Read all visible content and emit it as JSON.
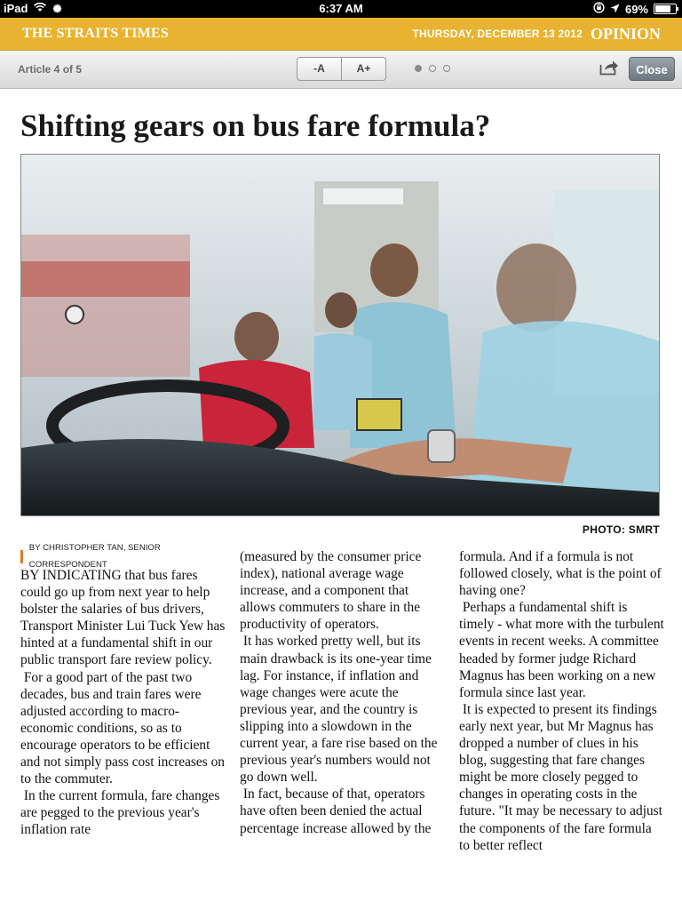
{
  "status_bar": {
    "device": "iPad",
    "time": "6:37 AM",
    "battery": "69%"
  },
  "banner": {
    "brand": "THE STRAITS TIMES",
    "date": "THURSDAY, DECEMBER 13 2012",
    "section": "OPINION"
  },
  "toolbar": {
    "counter": "Article 4 of 5",
    "decrease_font_label": "-A",
    "increase_font_label": "A+",
    "page_dots": [
      {
        "active": true
      },
      {
        "active": false
      },
      {
        "active": false
      }
    ],
    "close_label": "Close"
  },
  "article": {
    "headline": "Shifting gears on bus fare formula?",
    "photo_credit": "PHOTO: SMRT",
    "byline": "BY CHRISTOPHER TAN, SENIOR CORRESPONDENT",
    "columns": [
      [
        "BY INDICATING that bus fares could go up from next year to help bolster the salaries of bus drivers, Transport Minister Lui Tuck Yew has hinted at a fundamental shift in our public transport fare review policy.",
        "For a good part of the past two decades, bus and train fares were adjusted according to macro-economic conditions, so as to encourage operators to be efficient and not simply pass cost increases on to the commuter.",
        "In the current formula, fare changes are pegged to the previous year's inflation rate"
      ],
      [
        "(measured by the consumer price index), national average wage increase, and a component that allows commuters to share in the productivity of operators.",
        "It has worked pretty well, but its main drawback is its one-year time lag. For instance, if inflation and wage changes were acute the previous year, and the country is slipping into a slowdown in the current year, a fare rise based on the previous year's numbers would not go down well.",
        "In fact, because of that, operators have often been denied the actual percentage increase allowed by the"
      ],
      [
        "formula. And if a formula is not followed closely, what is the point of having one?",
        "Perhaps a fundamental shift is timely - what more with the turbulent events in recent weeks. A committee headed by former judge Richard Magnus has been working on a new formula since last year.",
        "It is expected to present its findings early next year, but Mr Magnus has dropped a number of clues in his blog, suggesting that fare changes might be more closely pegged to changes in operating costs in the future. \"It may be necessary to adjust the components of the fare formula to better reflect"
      ]
    ]
  },
  "colors": {
    "banner": "#e8b330",
    "byline_mark": "#e07a22",
    "close_button": "#7d868e"
  }
}
